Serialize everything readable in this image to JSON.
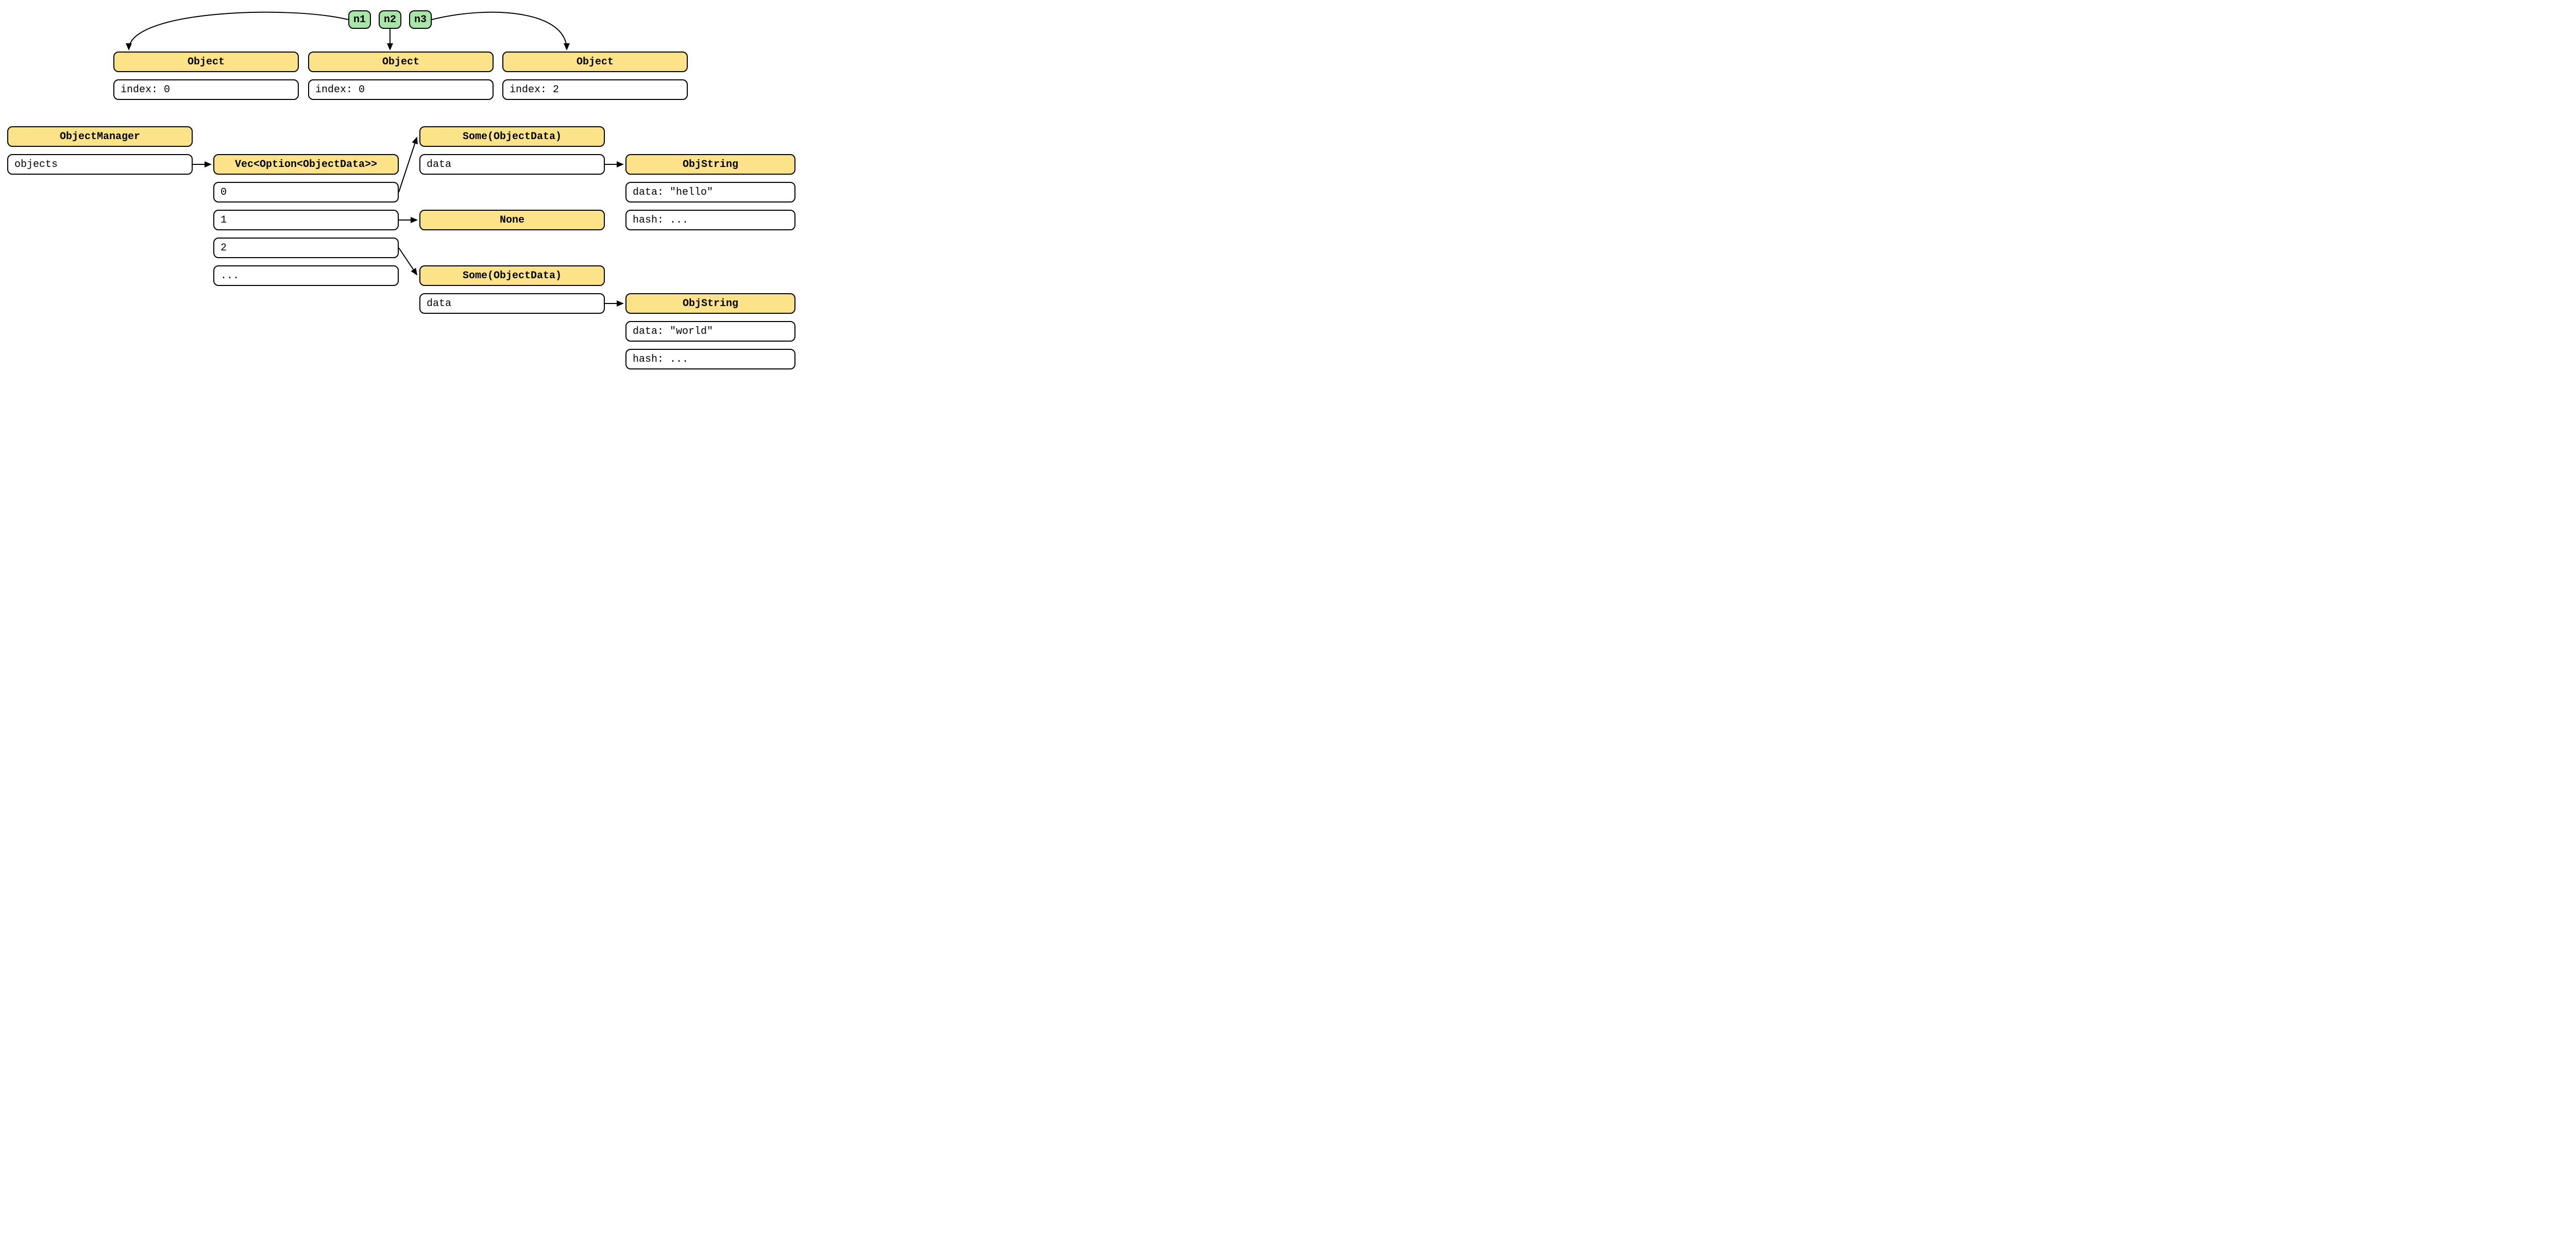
{
  "pointers": {
    "n1": "n1",
    "n2": "n2",
    "n3": "n3"
  },
  "objects": {
    "obj1_title": "Object",
    "obj1_field": "index: 0",
    "obj2_title": "Object",
    "obj2_field": "index: 0",
    "obj3_title": "Object",
    "obj3_field": "index: 2"
  },
  "manager": {
    "title": "ObjectManager",
    "field": "objects"
  },
  "vec": {
    "title": "Vec<Option<ObjectData>>",
    "i0": "0",
    "i1": "1",
    "i2": "2",
    "more": "..."
  },
  "opt0": {
    "title": "Some(ObjectData)",
    "field": "data"
  },
  "opt1": {
    "title": "None"
  },
  "opt2": {
    "title": "Some(ObjectData)",
    "field": "data"
  },
  "str0": {
    "title": "ObjString",
    "data": "data: \"hello\"",
    "hash": "hash: ..."
  },
  "str2": {
    "title": "ObjString",
    "data": "data: \"world\"",
    "hash": "hash: ..."
  }
}
